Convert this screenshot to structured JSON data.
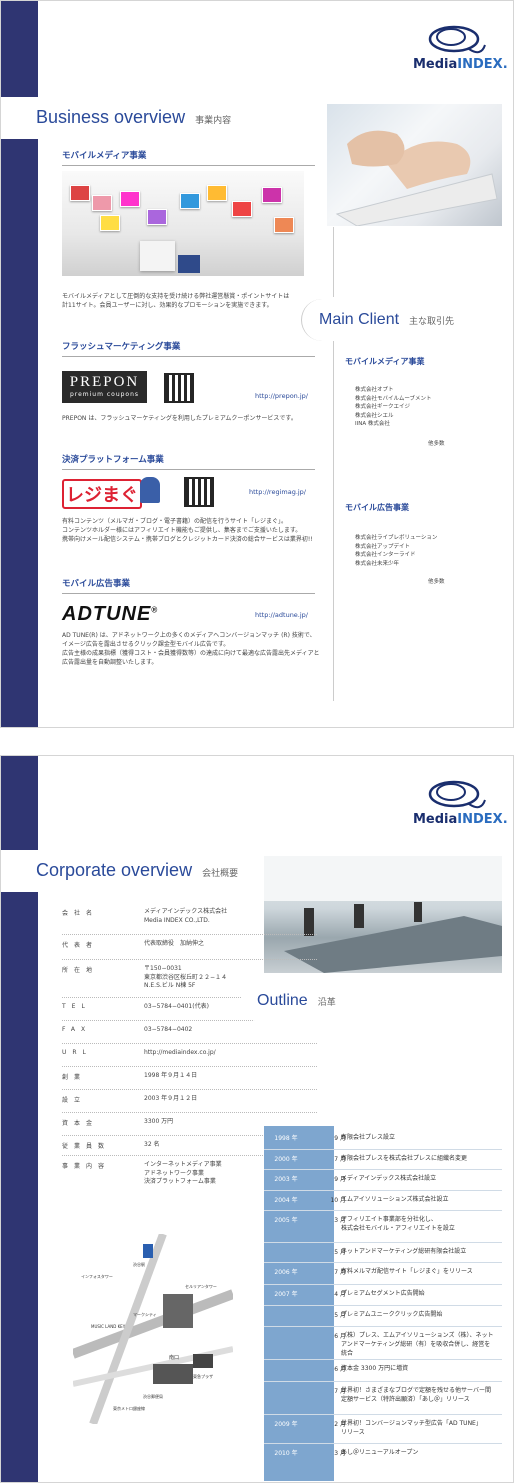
{
  "page1": {
    "logo": {
      "part1": "Media",
      "part2": "INDEX."
    },
    "title": "Business overview",
    "title_jp": "事業内容",
    "sections": [
      {
        "heading": "モバイルメディア事業",
        "text": [
          "モバイルメディアとして圧倒的な支持を受け続ける弊社運営懸賞・ポイントサイトは",
          "計11サイト。会員ユーザーに対し、効果的なプロモーションを実施できます。"
        ]
      },
      {
        "heading": "フラッシュマーケティング事業",
        "logo_text": "PREPON",
        "logo_sub": "premium coupons",
        "link": "http://prepon.jp/",
        "text": [
          "PREPON は、フラッシュマーケティングを利用したプレミアムクーポンサービスです。"
        ]
      },
      {
        "heading": "決済プラットフォーム事業",
        "logo_text": "レジまぐ",
        "link": "http://regimag.jp/",
        "text": [
          "有料コンテンツ（メルマガ・ブログ・電子書籍）の配信を行うサイト「レジまぐ」。",
          "コンテンツホルダー様にはアフィリエイト機能もご提供し、集客までご支援いたします。",
          "携帯向けメール配信システム・携帯ブログとクレジットカード決済の総合サービスは業界初!!"
        ]
      },
      {
        "heading": "モバイル広告事業",
        "logo_text": "ADTUNE",
        "link": "http://adtune.jp/",
        "text": [
          "AD TUNE(R) は、アドネットワーク上の多くのメディアへコンバージョンマッチ (R) 技術で、",
          "イメージ広告を露出させるクリック課金型モバイル広告です。",
          "広告主様の成果指標（獲得コスト・会員獲得数等）の達成に向けて最適な広告露出先メディアと",
          "広告露出量を自動調整いたします。"
        ]
      }
    ],
    "client_title": "Main Client",
    "client_title_jp": "主な取引先",
    "clients": [
      {
        "heading": "モバイルメディア事業",
        "items": [
          "株式会社オプト",
          "株式会社モバイルムーブメント",
          "株式会社ギークエイジ",
          "株式会社シエル",
          "IINA 株式会社"
        ],
        "etc": "他多数"
      },
      {
        "heading": "モバイル広告事業",
        "items": [
          "株式会社ライブレボリューション",
          "株式会社アップデイト",
          "株式会社インターライド",
          "株式会社未来少年"
        ],
        "etc": "他多数"
      }
    ]
  },
  "page2": {
    "logo": {
      "part1": "Media",
      "part2": "INDEX."
    },
    "title": "Corporate overview",
    "title_jp": "会社概要",
    "rows": [
      {
        "label": "会社名",
        "value": [
          "メディアインデックス株式会社",
          "Media INDEX CO.,LTD."
        ]
      },
      {
        "label": "代表者",
        "value": [
          "代表取締役　加納伸之"
        ]
      },
      {
        "label": "所在地",
        "value": [
          "〒150−0031",
          "東京都渋谷区桜丘町２２−１４",
          "N.E.S.ビル N棟 5F"
        ]
      },
      {
        "label": "TEL",
        "value": [
          "03−5784−0401(代表)"
        ]
      },
      {
        "label": "FAX",
        "value": [
          "03−5784−0402"
        ]
      },
      {
        "label": "URL",
        "value": [
          "http://mediaindex.co.jp/"
        ]
      },
      {
        "label": "創業",
        "value": [
          "1998 年９月１４日"
        ]
      },
      {
        "label": "設立",
        "value": [
          "2003 年９月１２日"
        ]
      },
      {
        "label": "資本金",
        "value": [
          "3300 万円"
        ]
      },
      {
        "label": "従業員数",
        "value": [
          "32 名"
        ]
      },
      {
        "label": "事業内容",
        "value": [
          "インターネットメディア事業",
          "アドネットワーク事業",
          "決済プラットフォーム事業"
        ]
      }
    ],
    "outline_title": "Outline",
    "outline_title_jp": "沿革",
    "history": [
      {
        "year": "1998 年",
        "month": "9 月",
        "event": [
          "有限会社プレス設立"
        ]
      },
      {
        "year": "2000 年",
        "month": "7 月",
        "event": [
          "有限会社プレスを株式会社プレスに組織名変更"
        ]
      },
      {
        "year": "2003 年",
        "month": "9 月",
        "event": [
          "メディアインデックス株式会社設立"
        ]
      },
      {
        "year": "2004 年",
        "month": "10 月",
        "event": [
          "エムアイソリューションズ株式会社設立"
        ]
      },
      {
        "year": "2005 年",
        "month": "3 月",
        "event": [
          "アフィリエイト事業部を分社化し、",
          "株式会社モバイル・アフィリエイトを設立"
        ]
      },
      {
        "year": "",
        "month": "5 月",
        "event": [
          "ネットアンドマーケティング総研有限会社設立"
        ]
      },
      {
        "year": "2006 年",
        "month": "7 月",
        "event": [
          "有料メルマガ配信サイト「レジまぐ」をリリース"
        ]
      },
      {
        "year": "2007 年",
        "month": "4 月",
        "event": [
          "プレミアムセグメント広告開始"
        ]
      },
      {
        "year": "",
        "month": "5 月",
        "event": [
          "プレミアムユニーククリック広告開始"
        ]
      },
      {
        "year": "",
        "month": "6 月",
        "event": [
          "（株）プレス、エムアイソリューションズ（株）、ネット",
          "アンドマーケティング総研（有）を吸収合併し、経営を",
          "統合"
        ]
      },
      {
        "year": "",
        "month": "6 月",
        "event": [
          "資本金 3300 万円に増資"
        ]
      },
      {
        "year": "",
        "month": "7 月",
        "event": [
          "世界初！さまざまなブログで定額を残せる他サーバー間",
          "定額サービス（特許出願済）「あし＠」リリース"
        ]
      },
      {
        "year": "2009 年",
        "month": "2 月",
        "event": [
          "世界初！コンバージョンマッチ型広告「AD TUNE」",
          "リリース"
        ]
      },
      {
        "year": "2010 年",
        "month": "3 月",
        "event": [
          "あし＠リニューアルオープン"
        ]
      }
    ],
    "map_labels": [
      "渋谷駅",
      "インフォスタワー",
      "マークシティ",
      "セルリアンタワー",
      "MUSIC LAND KEY",
      "南口",
      "渋谷郵便局",
      "東急プラザ",
      "東京メトロ銀座線"
    ]
  },
  "colors": {
    "navy": "#2f3572",
    "accent": "#2a4a9a",
    "outline_band": "#7ea6cf"
  }
}
